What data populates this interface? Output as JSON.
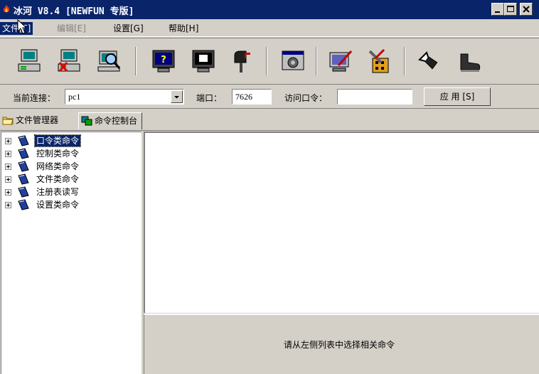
{
  "window": {
    "title": "冰河 V8.4 [NEWFUN 专版]",
    "icons": {
      "app": "fire-icon",
      "minimize": "minimize-icon",
      "maximize": "maximize-icon",
      "close": "close-icon"
    }
  },
  "menu": {
    "file": "文件[F]",
    "edit": "编辑[E]",
    "settings": "设置[G]",
    "help": "帮助[H]"
  },
  "toolbar": {
    "buttons": [
      "connect-computer-icon",
      "disconnect-computer-icon",
      "search-computer-icon",
      "help-monitor-icon",
      "screen-control-icon",
      "mailbox-icon",
      "system-settings-icon",
      "edit-monitor-icon",
      "tools-icon",
      "arrow-icon",
      "boot-icon"
    ]
  },
  "connection": {
    "current_label": "当前连接：",
    "current_value": "pc1",
    "port_label": "端口：",
    "port_value": "7626",
    "password_label": "访问口令：",
    "password_value": "",
    "apply_label": "应 用 [S]"
  },
  "tabs": [
    {
      "label": "文件管理器",
      "icon": "folder-icon",
      "active": false
    },
    {
      "label": "命令控制台",
      "icon": "console-icon",
      "active": true
    }
  ],
  "tree": {
    "items": [
      {
        "label": "口令类命令",
        "selected": true
      },
      {
        "label": "控制类命令",
        "selected": false
      },
      {
        "label": "网络类命令",
        "selected": false
      },
      {
        "label": "文件类命令",
        "selected": false
      },
      {
        "label": "注册表读写",
        "selected": false
      },
      {
        "label": "设置类命令",
        "selected": false
      }
    ]
  },
  "hint": "请从左侧列表中选择相关命令",
  "colors": {
    "titlebar": "#0a246a",
    "face": "#d4d0c8",
    "selection": "#0a246a"
  }
}
